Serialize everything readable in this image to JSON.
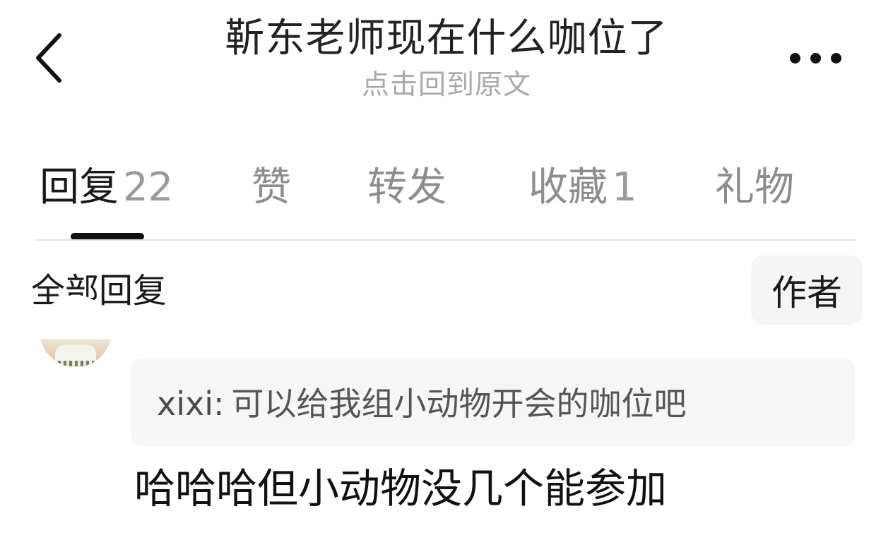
{
  "header": {
    "back_icon": "chevron-left-icon",
    "title": "靳东老师现在什么咖位了",
    "subtitle": "点击回到原文",
    "more_icon": "more-dots-icon"
  },
  "tabs": [
    {
      "label": "回复",
      "count": "22",
      "active": true
    },
    {
      "label": "赞",
      "count": ""
    },
    {
      "label": "转发",
      "count": ""
    },
    {
      "label": "收藏",
      "count": "1"
    },
    {
      "label": "礼物",
      "count": ""
    }
  ],
  "section": {
    "title": "全部回复",
    "author_filter": "作者"
  },
  "comment": {
    "quote_user": "xixi",
    "quote_colon": ":",
    "quote_text": "可以给我组小动物开会的咖位吧",
    "reply_text": "哈哈哈但小动物没几个能参加"
  }
}
